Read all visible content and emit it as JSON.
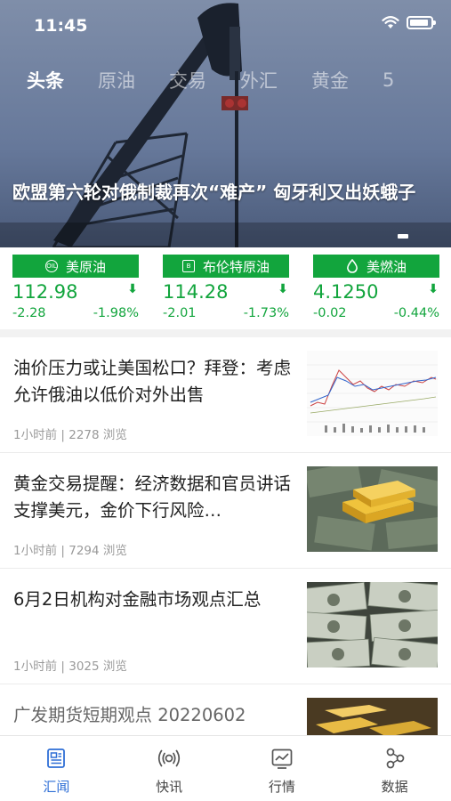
{
  "status_bar": {
    "time": "11:45"
  },
  "tabs": [
    {
      "label": "头条",
      "active": true
    },
    {
      "label": "原油",
      "active": false
    },
    {
      "label": "交易",
      "active": false
    },
    {
      "label": "外汇",
      "active": false
    },
    {
      "label": "黄金",
      "active": false
    },
    {
      "label": "5",
      "active": false
    }
  ],
  "hero": {
    "headline": "欧盟第六轮对俄制裁再次“难产” 匈牙利又出妖蛾子"
  },
  "quotes": [
    {
      "name": "美原油",
      "icon": "oil-badge-icon",
      "price": "112.98",
      "change": "-2.28",
      "change_pct": "-1.98%",
      "trend": "down"
    },
    {
      "name": "布伦特原油",
      "icon": "brent-badge-icon",
      "price": "114.28",
      "change": "-2.01",
      "change_pct": "-1.73%",
      "trend": "down"
    },
    {
      "name": "美燃油",
      "icon": "fuel-drop-icon",
      "price": "4.1250",
      "change": "-0.02",
      "change_pct": "-0.44%",
      "trend": "down"
    }
  ],
  "news": [
    {
      "title": "油价压力或让美国松口？拜登：考虑允许俄油以低价对外出售",
      "time": "1小时前",
      "views": "2278 浏览",
      "thumb": "chart"
    },
    {
      "title": "黄金交易提醒：经济数据和官员讲话支撑美元，金价下行风险…",
      "time": "1小时前",
      "views": "7294 浏览",
      "thumb": "gold"
    },
    {
      "title": "6月2日机构对金融市场观点汇总",
      "time": "1小时前",
      "views": "3025 浏览",
      "thumb": "dollars"
    },
    {
      "title": "广发期货短期观点 20220602",
      "time": "",
      "views": "",
      "thumb": "goldbars"
    }
  ],
  "tabbar": [
    {
      "label": "汇闻",
      "icon": "news-icon",
      "active": true
    },
    {
      "label": "快讯",
      "icon": "broadcast-icon",
      "active": false
    },
    {
      "label": "行情",
      "icon": "market-icon",
      "active": false
    },
    {
      "label": "数据",
      "icon": "data-icon",
      "active": false
    }
  ],
  "colors": {
    "up_down_green": "#12a53d",
    "tab_active_blue": "#2f6fd6"
  }
}
